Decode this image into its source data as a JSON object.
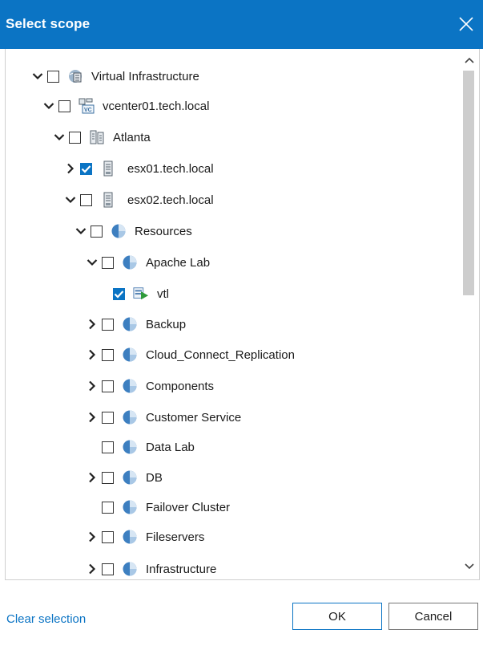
{
  "dialog": {
    "title": "Select scope"
  },
  "tree": {
    "nodes": [
      {
        "label": "Virtual Infrastructure",
        "expanded": true,
        "checked": false,
        "icon": "virtual-infrastructure-icon"
      },
      {
        "label": "vcenter01.tech.local",
        "expanded": true,
        "checked": false,
        "icon": "vcenter-icon"
      },
      {
        "label": "Atlanta",
        "expanded": true,
        "checked": false,
        "icon": "datacenter-icon"
      },
      {
        "label": "esx01.tech.local",
        "expanded": false,
        "checked": true,
        "icon": "host-icon"
      },
      {
        "label": "esx02.tech.local",
        "expanded": true,
        "checked": false,
        "icon": "host-icon"
      },
      {
        "label": "Resources",
        "expanded": true,
        "checked": false,
        "icon": "resource-pool-icon"
      },
      {
        "label": "Apache Lab",
        "expanded": true,
        "checked": false,
        "icon": "resource-pool-icon"
      },
      {
        "label": "vtl",
        "expanded": null,
        "checked": true,
        "icon": "vm-icon"
      },
      {
        "label": "Backup",
        "expanded": false,
        "checked": false,
        "icon": "resource-pool-icon"
      },
      {
        "label": "Cloud_Connect_Replication",
        "expanded": false,
        "checked": false,
        "icon": "resource-pool-icon"
      },
      {
        "label": "Components",
        "expanded": false,
        "checked": false,
        "icon": "resource-pool-icon"
      },
      {
        "label": "Customer Service",
        "expanded": false,
        "checked": false,
        "icon": "resource-pool-icon"
      },
      {
        "label": "Data Lab",
        "expanded": null,
        "checked": false,
        "icon": "resource-pool-icon"
      },
      {
        "label": "DB",
        "expanded": false,
        "checked": false,
        "icon": "resource-pool-icon"
      },
      {
        "label": "Failover Cluster",
        "expanded": null,
        "checked": false,
        "icon": "resource-pool-icon"
      },
      {
        "label": "Fileservers",
        "expanded": false,
        "checked": false,
        "icon": "resource-pool-icon"
      },
      {
        "label": "Infrastructure",
        "expanded": false,
        "checked": false,
        "icon": "resource-pool-icon"
      }
    ]
  },
  "footer": {
    "clear_label": "Clear selection",
    "ok_label": "OK",
    "cancel_label": "Cancel"
  },
  "colors": {
    "accent": "#0b74c4",
    "text": "#1a1a1a",
    "checkbox_checked": "#0b74c4"
  }
}
